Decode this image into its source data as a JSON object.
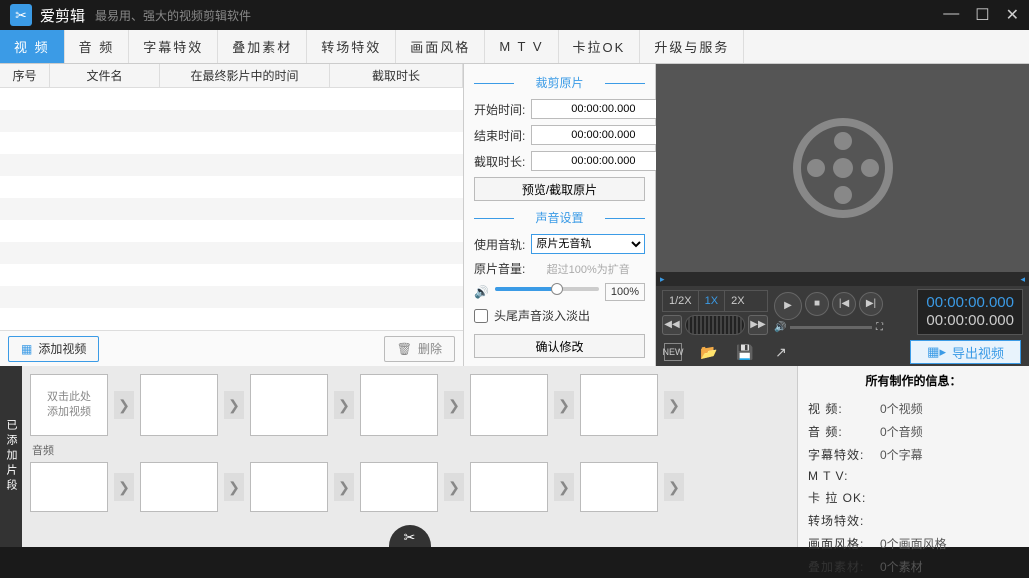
{
  "app": {
    "title": "爱剪辑",
    "subtitle": "最易用、强大的视频剪辑软件"
  },
  "tabs": [
    "视 频",
    "音 频",
    "字幕特效",
    "叠加素材",
    "转场特效",
    "画面风格",
    "M T V",
    "卡拉OK",
    "升级与服务"
  ],
  "columns": {
    "seq": "序号",
    "filename": "文件名",
    "time_in_movie": "在最终影片中的时间",
    "clip_len": "截取时长"
  },
  "buttons": {
    "add_video": "添加视频",
    "delete": "删除",
    "preview_cut": "预览/截取原片",
    "confirm": "确认修改",
    "export": "导出视频"
  },
  "crop": {
    "title": "裁剪原片",
    "start_label": "开始时间:",
    "start_value": "00:00:00.000",
    "end_label": "结束时间:",
    "end_value": "00:00:00.000",
    "len_label": "截取时长:",
    "len_value": "00:00:00.000"
  },
  "sound": {
    "title": "声音设置",
    "track_label": "使用音轨:",
    "track_value": "原片无音轨",
    "vol_label": "原片音量:",
    "vol_hint": "超过100%为扩音",
    "vol_pct": "100%",
    "fade_label": "头尾声音淡入淡出"
  },
  "player": {
    "speeds": [
      "1/2X",
      "1X",
      "2X"
    ],
    "time1": "00:00:00.000",
    "time2": "00:00:00.000"
  },
  "timeline": {
    "side_label": "已添加片段",
    "first_clip_hint": "双击此处\n添加视频",
    "audio_label": "音频"
  },
  "info": {
    "title": "所有制作的信息：",
    "rows": [
      {
        "k": "视    频:",
        "v": "0个视频"
      },
      {
        "k": "音    频:",
        "v": "0个音频"
      },
      {
        "k": "字幕特效:",
        "v": "0个字幕"
      },
      {
        "k": "M  T  V:",
        "v": ""
      },
      {
        "k": "卡 拉 OK:",
        "v": ""
      },
      {
        "k": "转场特效:",
        "v": ""
      },
      {
        "k": "画面风格:",
        "v": "0个画面风格"
      },
      {
        "k": "叠加素材:",
        "v": "0个素材"
      }
    ]
  }
}
